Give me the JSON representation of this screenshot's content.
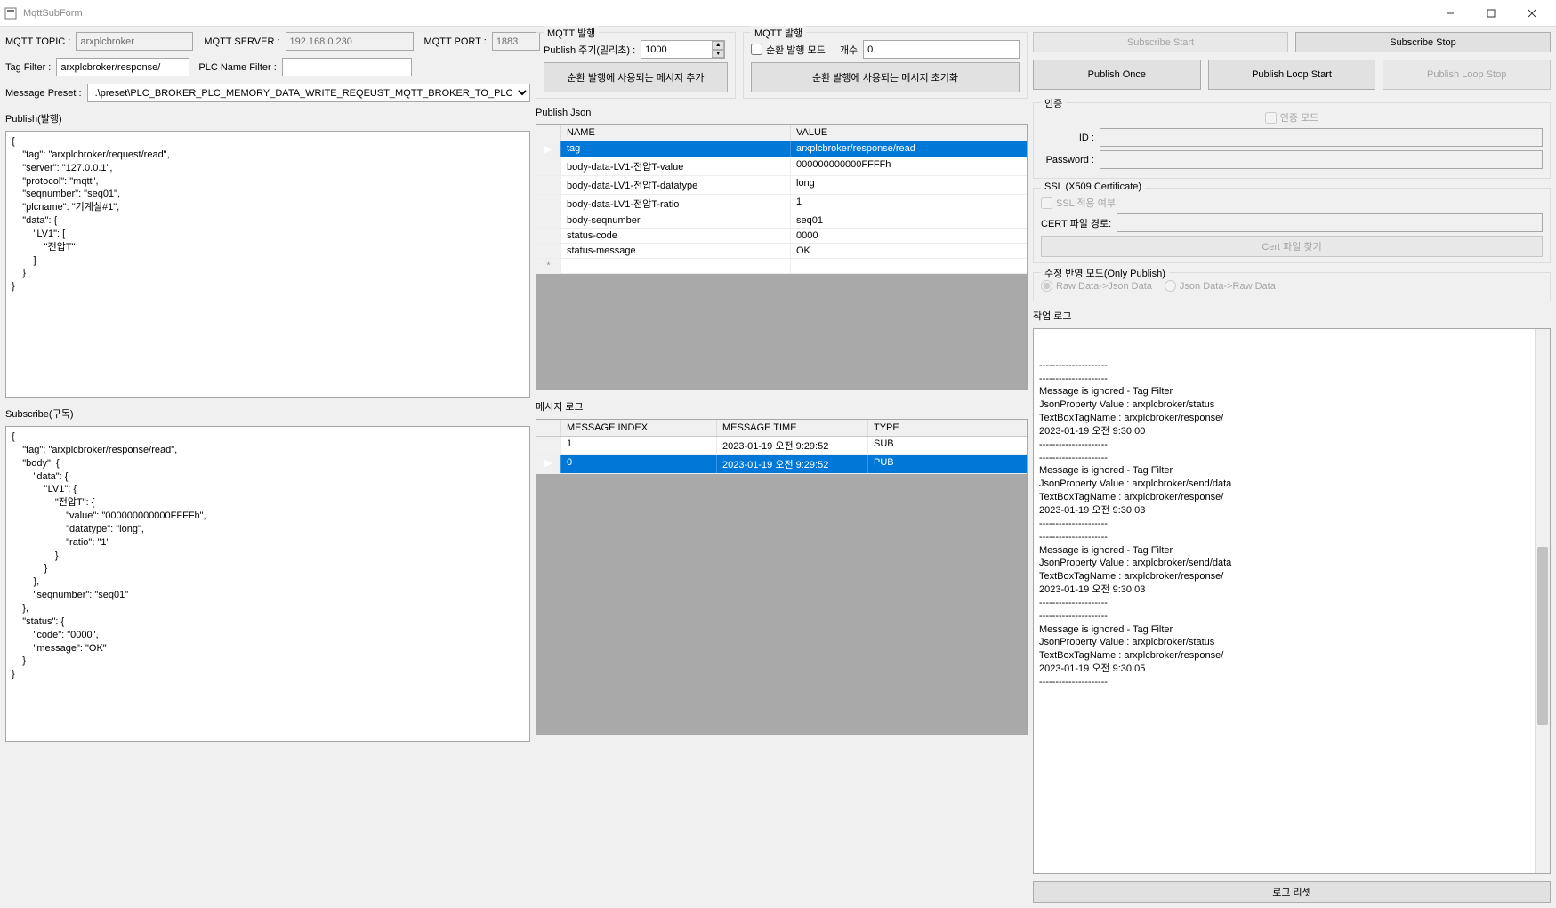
{
  "window": {
    "title": "MqttSubForm"
  },
  "topRow": {
    "mqttTopicLabel": "MQTT TOPIC :",
    "mqttTopicValue": "arxplcbroker",
    "mqttServerLabel": "MQTT SERVER :",
    "mqttServerValue": "192.168.0.230",
    "mqttPortLabel": "MQTT PORT :",
    "mqttPortValue": "1883"
  },
  "filterRow": {
    "tagFilterLabel": "Tag Filter :",
    "tagFilterValue": "arxplcbroker/response/",
    "plcNameFilterLabel": "PLC Name Filter :",
    "plcNameFilterValue": ""
  },
  "presetRow": {
    "label": "Message Preset :",
    "value": ".\\preset\\PLC_BROKER_PLC_MEMORY_DATA_WRITE_REQEUST_MQTT_BROKER_TO_PLC_BROKER.json"
  },
  "publishGroup": {
    "title": "MQTT 발행",
    "periodLabel": "Publish 주기(밀리초) :",
    "periodValue": "1000",
    "addBtn": "순환 발행에 사용되는 메시지 추가"
  },
  "loopGroup": {
    "title": "MQTT 발행",
    "loopModeLabel": "순환 발행 모드",
    "countLabel": "개수",
    "countValue": "0",
    "resetBtn": "순환 발행에 사용되는 메시지 초기화"
  },
  "subscribeBtns": {
    "start": "Subscribe Start",
    "stop": "Subscribe Stop",
    "pubOnce": "Publish Once",
    "pubLoopStart": "Publish Loop Start",
    "pubLoopStop": "Publish Loop Stop"
  },
  "authGroup": {
    "title": "인증",
    "modeLabel": "인증 모드",
    "idLabel": "ID :",
    "idValue": "",
    "pwLabel": "Password :",
    "pwValue": ""
  },
  "sslGroup": {
    "title": "SSL (X509 Certificate)",
    "applyLabel": "SSL 적용 여부",
    "certPathLabel": "CERT 파일 경로:",
    "certPathValue": "",
    "findBtn": "Cert 파일 찾기"
  },
  "reflectGroup": {
    "title": "수정 반영 모드(Only Publish)",
    "opt1": "Raw Data->Json Data",
    "opt2": "Json Data->Raw Data"
  },
  "logGroup": {
    "title": "작업 로그",
    "resetBtn": "로그 리셋",
    "text": "---------------------\n---------------------\nMessage is ignored - Tag Filter\nJsonProperty Value : arxplcbroker/status\nTextBoxTagName : arxplcbroker/response/\n2023-01-19 오전 9:30:00\n---------------------\n---------------------\nMessage is ignored - Tag Filter\nJsonProperty Value : arxplcbroker/send/data\nTextBoxTagName : arxplcbroker/response/\n2023-01-19 오전 9:30:03\n---------------------\n---------------------\nMessage is ignored - Tag Filter\nJsonProperty Value : arxplcbroker/send/data\nTextBoxTagName : arxplcbroker/response/\n2023-01-19 오전 9:30:03\n---------------------\n---------------------\nMessage is ignored - Tag Filter\nJsonProperty Value : arxplcbroker/status\nTextBoxTagName : arxplcbroker/response/\n2023-01-19 오전 9:30:05\n---------------------"
  },
  "publishSection": {
    "label": "Publish(발행)",
    "text": "{\n    \"tag\": \"arxplcbroker/request/read\",\n    \"server\": \"127.0.0.1\",\n    \"protocol\": \"mqtt\",\n    \"seqnumber\": \"seq01\",\n    \"plcname\": \"기계실#1\",\n    \"data\": {\n        \"LV1\": [\n            \"전압T\"\n        ]\n    }\n}"
  },
  "subscribeSection": {
    "label": "Subscribe(구독)",
    "text": "{\n    \"tag\": \"arxplcbroker/response/read\",\n    \"body\": {\n        \"data\": {\n            \"LV1\": {\n                \"전압T\": {\n                    \"value\": \"000000000000FFFFh\",\n                    \"datatype\": \"long\",\n                    \"ratio\": \"1\"\n                }\n            }\n        },\n        \"seqnumber\": \"seq01\"\n    },\n    \"status\": {\n        \"code\": \"0000\",\n        \"message\": \"OK\"\n    }\n}"
  },
  "jsonGrid": {
    "label": "Publish Json",
    "headers": {
      "name": "NAME",
      "value": "VALUE"
    },
    "rows": [
      {
        "name": "tag",
        "value": "arxplcbroker/response/read",
        "selected": true
      },
      {
        "name": "body-data-LV1-전압T-value",
        "value": "000000000000FFFFh"
      },
      {
        "name": "body-data-LV1-전압T-datatype",
        "value": "long"
      },
      {
        "name": "body-data-LV1-전압T-ratio",
        "value": "1"
      },
      {
        "name": "body-seqnumber",
        "value": "seq01"
      },
      {
        "name": "status-code",
        "value": "0000"
      },
      {
        "name": "status-message",
        "value": "OK"
      }
    ]
  },
  "msgGrid": {
    "label": "메시지 로그",
    "headers": {
      "idx": "MESSAGE INDEX",
      "time": "MESSAGE TIME",
      "type": "TYPE"
    },
    "rows": [
      {
        "idx": "1",
        "time": "2023-01-19 오전 9:29:52",
        "type": "SUB"
      },
      {
        "idx": "0",
        "time": "2023-01-19 오전 9:29:52",
        "type": "PUB",
        "selected": true
      }
    ]
  }
}
